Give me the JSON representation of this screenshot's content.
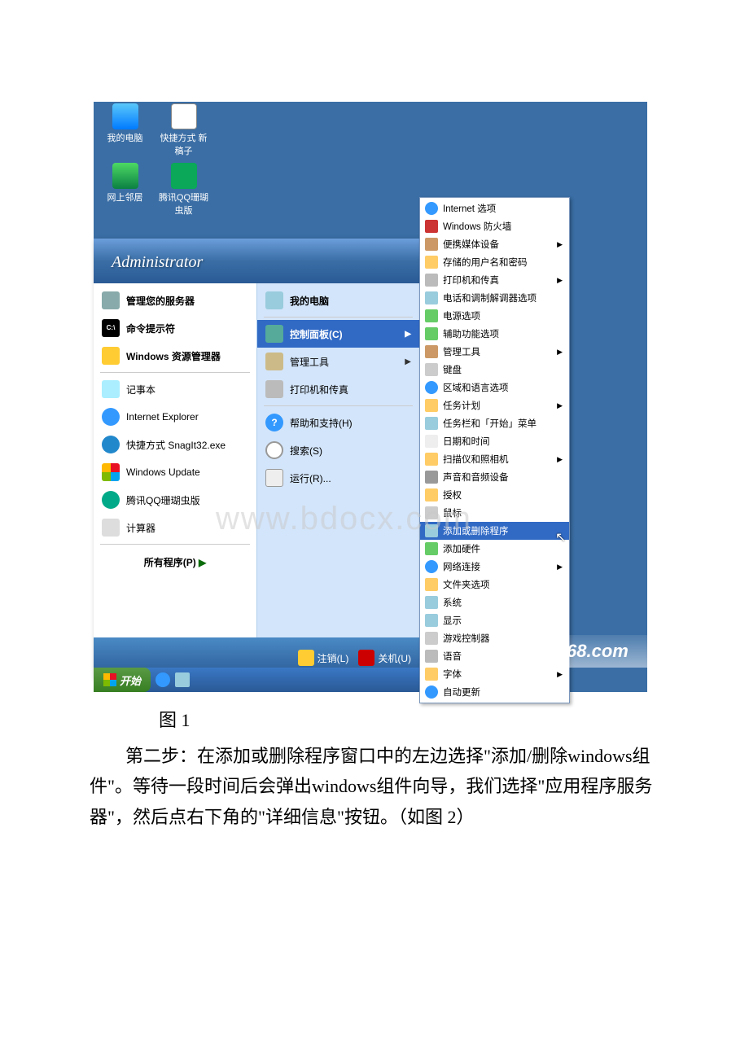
{
  "desktop_icons": {
    "my_computer": "我的电脑",
    "shortcut": "快捷方式 新稿子",
    "network": "网上邻居",
    "qq": "腾讯QQ珊瑚虫版"
  },
  "start_menu": {
    "username": "Administrator",
    "left": {
      "manage": "管理您的服务器",
      "cmd": "命令提示符",
      "explorer": "Windows 资源管理器",
      "notepad": "记事本",
      "ie": "Internet Explorer",
      "snagit": "快捷方式 SnagIt32.exe",
      "update": "Windows Update",
      "qq": "腾讯QQ珊瑚虫版",
      "calc": "计算器",
      "all_programs": "所有程序(P)"
    },
    "right": {
      "my_computer": "我的电脑",
      "control_panel": "控制面板(C)",
      "admin_tools": "管理工具",
      "printers": "打印机和传真",
      "help": "帮助和支持(H)",
      "search": "搜索(S)",
      "run": "运行(R)..."
    },
    "footer": {
      "logoff": "注销(L)",
      "shutdown": "关机(U)"
    }
  },
  "submenu": {
    "items": {
      "internet_options": "Internet 选项",
      "firewall": "Windows 防火墙",
      "portable": "便携媒体设备",
      "stored_pwd": "存储的用户名和密码",
      "printers": "打印机和传真",
      "phone_modem": "电话和调制解调器选项",
      "power": "电源选项",
      "accessibility": "辅助功能选项",
      "admin_tools": "管理工具",
      "keyboard": "键盘",
      "region": "区域和语言选项",
      "tasks": "任务计划",
      "taskbar": "任务栏和「开始」菜单",
      "datetime": "日期和时间",
      "scanner": "扫描仪和照相机",
      "sound": "声音和音频设备",
      "license": "授权",
      "mouse": "鼠标",
      "add_remove": "添加或删除程序",
      "add_hw": "添加硬件",
      "network": "网络连接",
      "folder_opts": "文件夹选项",
      "system": "系统",
      "display": "显示",
      "game": "游戏控制器",
      "speech": "语音",
      "fonts": "字体",
      "auto_update": "自动更新"
    }
  },
  "taskbar": {
    "start": "开始"
  },
  "watermark": "www.bdocx.com",
  "corner_logo": "IT 168.com",
  "caption": "图 1",
  "paragraph": "第二步：在添加或删除程序窗口中的左边选择\"添加/删除windows组件\"。等待一段时间后会弹出windows组件向导，我们选择\"应用程序服务器\"，然后点右下角的\"详细信息\"按钮。（如图 2）"
}
